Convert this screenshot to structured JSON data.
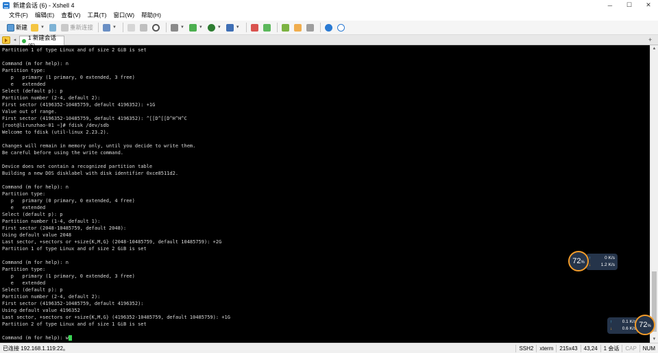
{
  "window": {
    "title": "新建会话 (6) - Xshell 4",
    "controls": {
      "minimize": "─",
      "maximize": "☐",
      "close": "✕"
    }
  },
  "menu": [
    "文件(F)",
    "编辑(E)",
    "查看(V)",
    "工具(T)",
    "窗口(W)",
    "帮助(H)"
  ],
  "toolbar": {
    "new_label": "新建",
    "reconnect_label": "重新连接"
  },
  "tab": {
    "active_label": "1 新建会话 (6)",
    "add": "+",
    "prev": "◂",
    "next": "▸"
  },
  "terminal": {
    "lines": [
      "Partition 1 of type Linux and of size 2 GiB is set",
      "",
      "Command (m for help): n",
      "Partition type:",
      "   p   primary (1 primary, 0 extended, 3 free)",
      "   e   extended",
      "Select (default p): p",
      "Partition number (2-4, default 2):",
      "First sector (4196352-10485759, default 4196352): +1G",
      "Value out of range.",
      "First sector (4196352-10485759, default 4196352): ^[[D^[[D^H^H^C",
      "[root@lirunzhao-01 ~]# fdisk /dev/sdb",
      "Welcome to fdisk (util-linux 2.23.2).",
      "",
      "Changes will remain in memory only, until you decide to write them.",
      "Be careful before using the write command.",
      "",
      "Device does not contain a recognized partition table",
      "Building a new DOS disklabel with disk identifier 0xce8511d2.",
      "",
      "Command (m for help): n",
      "Partition type:",
      "   p   primary (0 primary, 0 extended, 4 free)",
      "   e   extended",
      "Select (default p): p",
      "Partition number (1-4, default 1):",
      "First sector (2048-10485759, default 2048):",
      "Using default value 2048",
      "Last sector, +sectors or +size{K,M,G} (2048-10485759, default 10485759): +2G",
      "Partition 1 of type Linux and of size 2 GiB is set",
      "",
      "Command (m for help): n",
      "Partition type:",
      "   p   primary (1 primary, 0 extended, 3 free)",
      "   e   extended",
      "Select (default p): p",
      "Partition number (2-4, default 2):",
      "First sector (4196352-10485759, default 4196352):",
      "Using default value 4196352",
      "Last sector, +sectors or +size{K,M,G} (4196352-10485759, default 10485759): +1G",
      "Partition 2 of type Linux and of size 1 GiB is set",
      "",
      "Command (m for help): w"
    ]
  },
  "speed_widget_1": {
    "percent": "72",
    "unit": "%",
    "up": "0",
    "up_unit": "K/s",
    "down": "1.2",
    "down_unit": "K/s"
  },
  "speed_widget_2": {
    "percent": "72",
    "unit": "%",
    "up": "0.1",
    "up_unit": "K/s",
    "down": "0.6",
    "down_unit": "K/s"
  },
  "status": {
    "connection": "已连接 192.168.1.119:22。",
    "protocol": "SSH2",
    "term": "xterm",
    "size": "215x43",
    "cursor": "43,24",
    "sessions": "1 会话",
    "cap": "CAP",
    "num": "NUM"
  },
  "colors": {
    "terminal_bg": "#000000",
    "terminal_fg": "#d8d8d8",
    "cursor": "#39d353",
    "widget_ring": "#f39c2a"
  }
}
